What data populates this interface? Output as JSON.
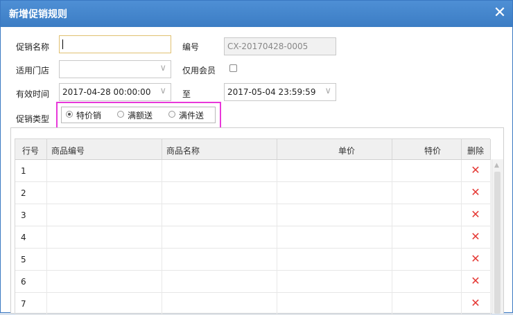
{
  "dialog": {
    "title": "新增促销规则",
    "close_glyph": "✕"
  },
  "form": {
    "promo_name_label": "促销名称",
    "promo_name_value": "",
    "code_label": "编号",
    "code_value": "CX-20170428-0005",
    "store_label": "适用门店",
    "store_value": "",
    "member_only_label": "仅用会员",
    "member_only_checked": false,
    "valid_time_label": "有效时间",
    "start_time": "2017-04-28 00:00:00",
    "to_label": "至",
    "end_time": "2017-05-04 23:59:59",
    "promo_type_label": "促销类型",
    "promo_types": [
      "特价销",
      "满额送",
      "满件送"
    ],
    "promo_type_selected": "特价销",
    "dropdown_glyph": "∨"
  },
  "table": {
    "columns": [
      "行号",
      "商品编号",
      "商品名称",
      "单价",
      "特价",
      "删除"
    ],
    "rows": [
      {
        "row_no": "1",
        "product_code": "",
        "product_name": "",
        "unit_price": "",
        "special_price": ""
      },
      {
        "row_no": "2",
        "product_code": "",
        "product_name": "",
        "unit_price": "",
        "special_price": ""
      },
      {
        "row_no": "3",
        "product_code": "",
        "product_name": "",
        "unit_price": "",
        "special_price": ""
      },
      {
        "row_no": "4",
        "product_code": "",
        "product_name": "",
        "unit_price": "",
        "special_price": ""
      },
      {
        "row_no": "5",
        "product_code": "",
        "product_name": "",
        "unit_price": "",
        "special_price": ""
      },
      {
        "row_no": "6",
        "product_code": "",
        "product_name": "",
        "unit_price": "",
        "special_price": ""
      },
      {
        "row_no": "7",
        "product_code": "",
        "product_name": "",
        "unit_price": "",
        "special_price": ""
      }
    ],
    "delete_glyph": "✕"
  },
  "colors": {
    "titlebar": "#3c7dc4",
    "highlight_box": "#e838d9",
    "delete_icon": "#e53935"
  }
}
